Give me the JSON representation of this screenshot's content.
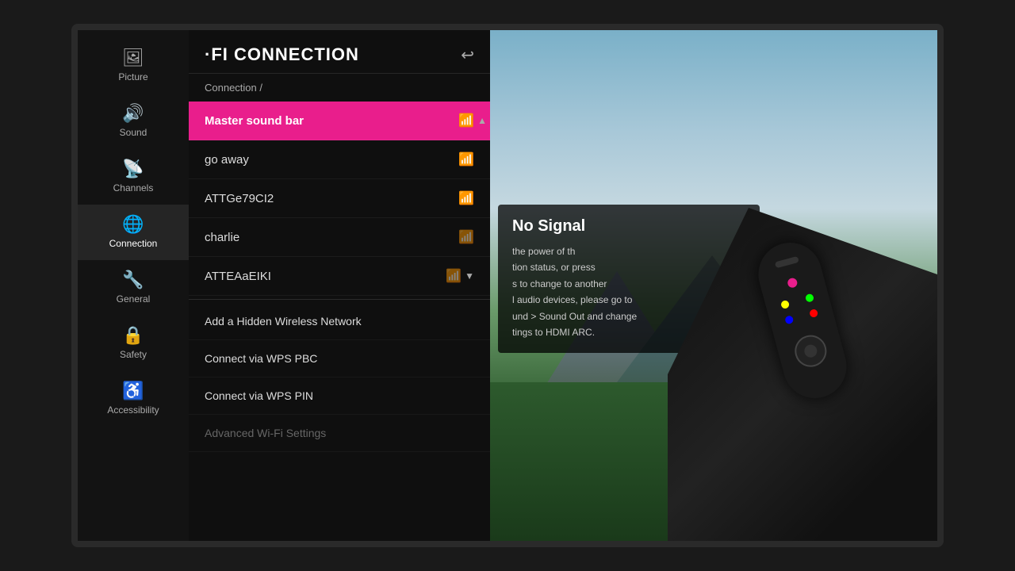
{
  "tv": {
    "sidebar": {
      "items": [
        {
          "id": "picture",
          "label": "Picture",
          "icon": "🖼",
          "active": false
        },
        {
          "id": "sound",
          "label": "Sound",
          "icon": "🔊",
          "active": false
        },
        {
          "id": "channels",
          "label": "Channels",
          "icon": "📡",
          "active": false
        },
        {
          "id": "connection",
          "label": "Connection",
          "icon": "🌐",
          "active": true
        },
        {
          "id": "general",
          "label": "General",
          "icon": "🔧",
          "active": false
        },
        {
          "id": "safety",
          "label": "Safety",
          "icon": "🔒",
          "active": false
        },
        {
          "id": "accessibility",
          "label": "Accessibility",
          "icon": "♿",
          "active": false
        }
      ]
    },
    "panel": {
      "title": "·FI CONNECTION",
      "breadcrumb": "Connection /",
      "back_button": "↩",
      "networks": [
        {
          "name": "Master sound bar",
          "signal": "strong",
          "selected": true
        },
        {
          "name": "go away",
          "signal": "strong",
          "selected": false
        },
        {
          "name": "ATTGe79CI2",
          "signal": "strong",
          "selected": false
        },
        {
          "name": "charlie",
          "signal": "weak",
          "selected": false
        },
        {
          "name": "ATTEAaEIKI",
          "signal": "weak",
          "selected": false
        }
      ],
      "actions": [
        {
          "id": "add-hidden",
          "label": "Add a Hidden Wireless Network",
          "disabled": false
        },
        {
          "id": "wps-pbc",
          "label": "Connect via WPS PBC",
          "disabled": false
        },
        {
          "id": "wps-pin",
          "label": "Connect via WPS PIN",
          "disabled": false
        },
        {
          "id": "advanced",
          "label": "Advanced Wi-Fi Settings",
          "disabled": true
        }
      ]
    },
    "no_signal": {
      "title": "No Signal",
      "lines": [
        "the power of th",
        "tion status, or press",
        "s to change to another",
        "l audio devices, please go to",
        "und > Sound Out and change",
        "tings to HDMI ARC."
      ]
    }
  }
}
